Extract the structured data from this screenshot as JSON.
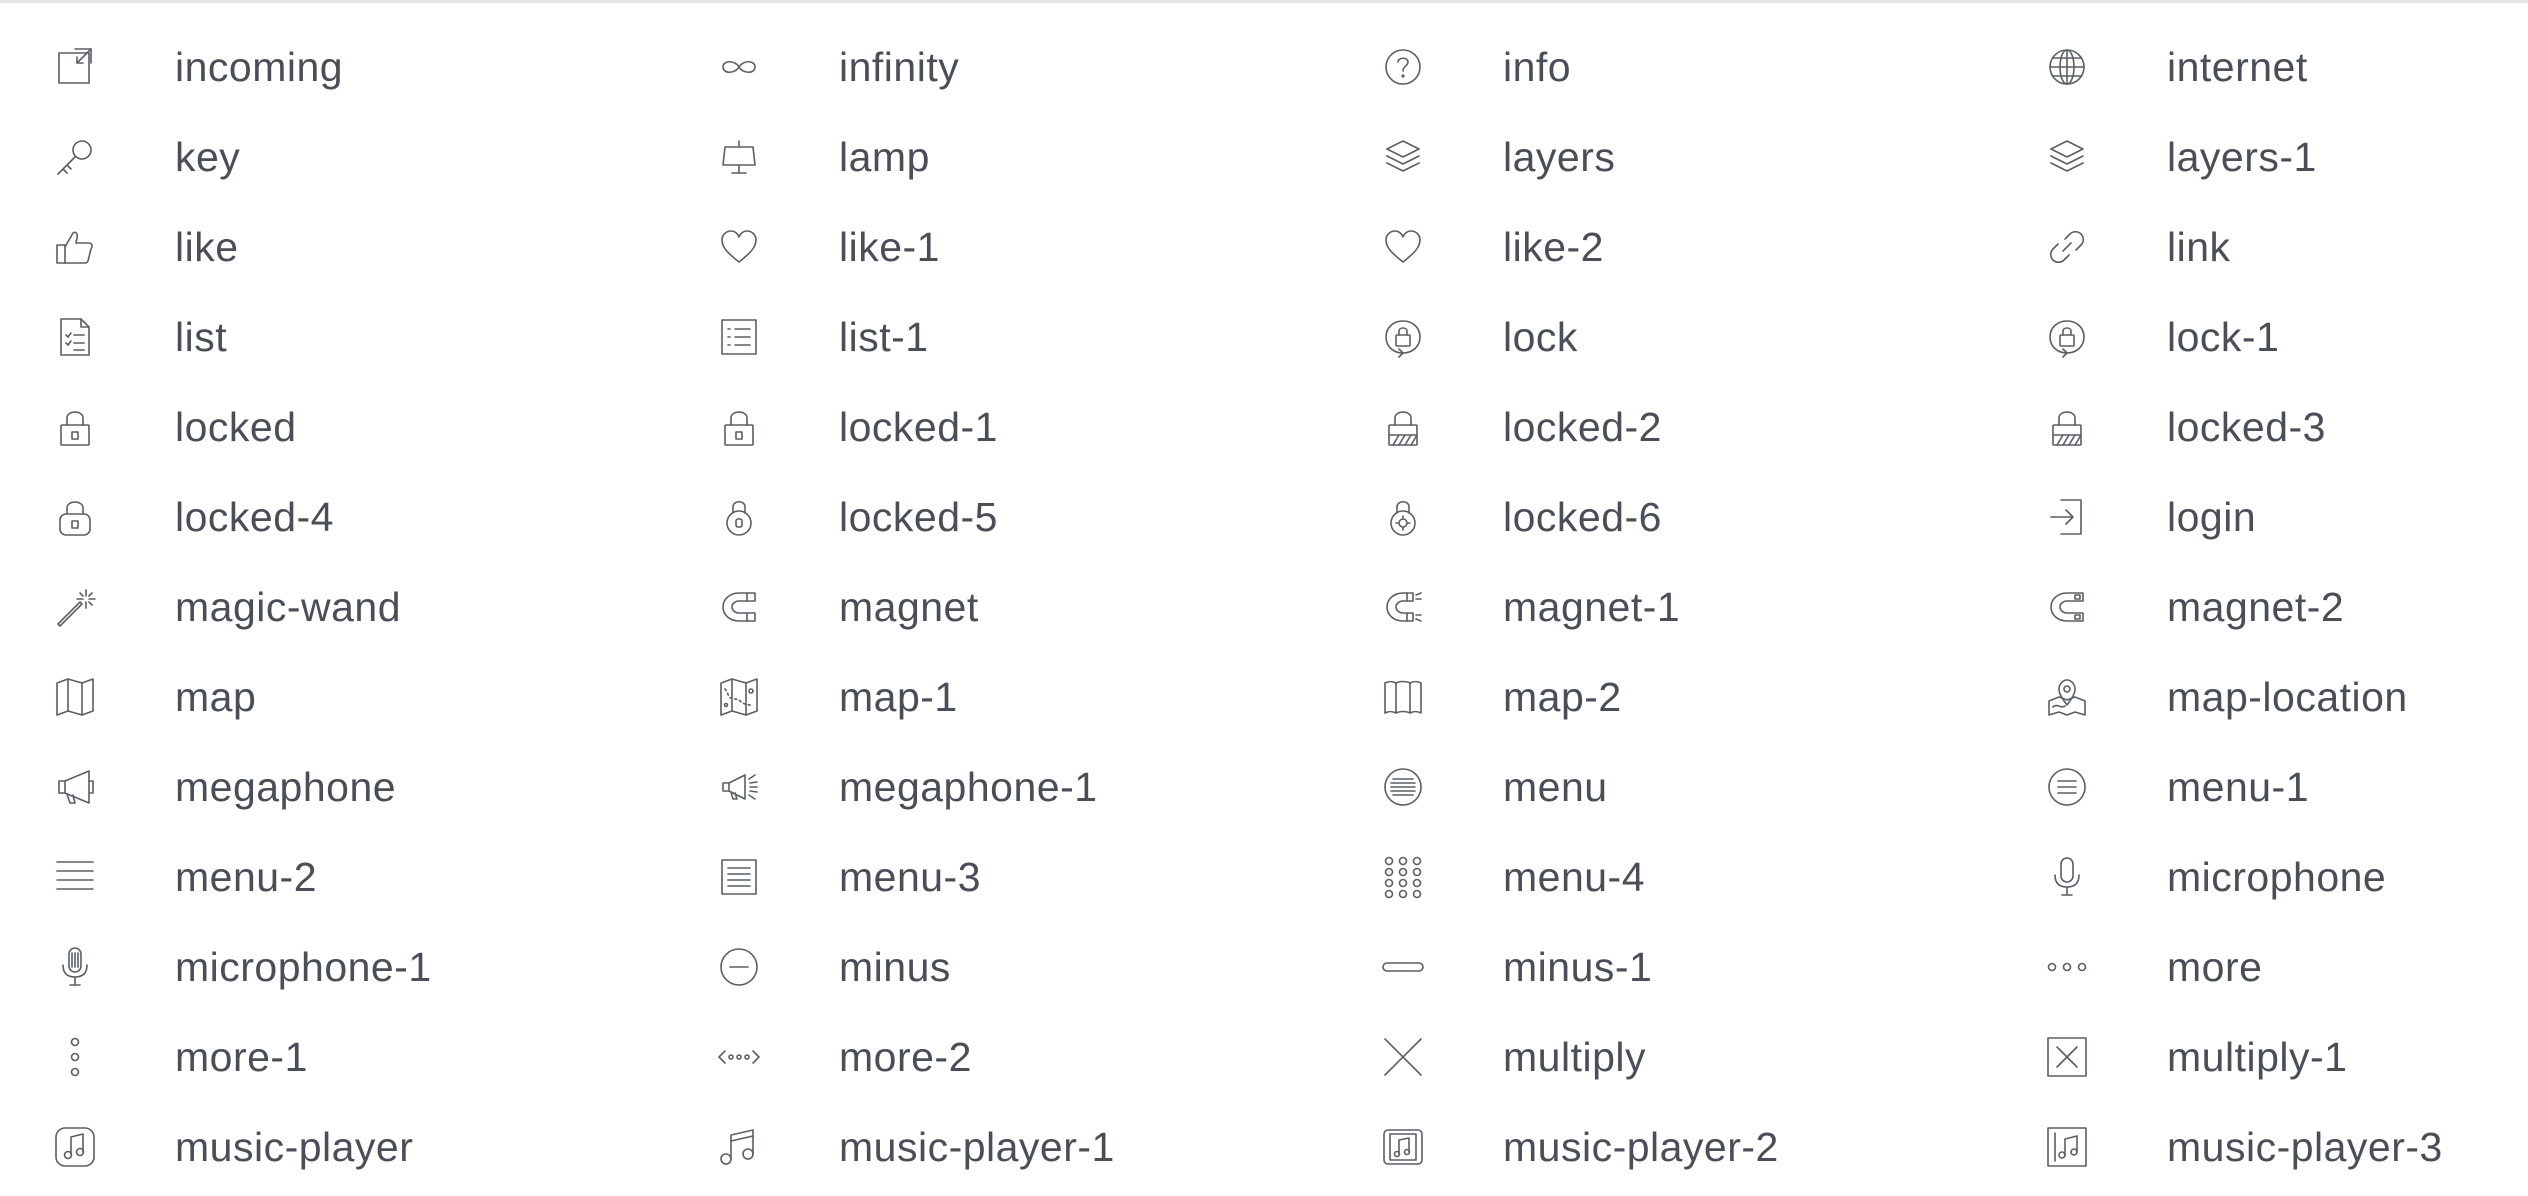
{
  "icons": [
    {
      "label": "incoming",
      "icon": "incoming-icon"
    },
    {
      "label": "infinity",
      "icon": "infinity-icon"
    },
    {
      "label": "info",
      "icon": "info-icon"
    },
    {
      "label": "internet",
      "icon": "internet-icon"
    },
    {
      "label": "key",
      "icon": "key-icon"
    },
    {
      "label": "lamp",
      "icon": "lamp-icon"
    },
    {
      "label": "layers",
      "icon": "layers-icon"
    },
    {
      "label": "layers-1",
      "icon": "layers-1-icon"
    },
    {
      "label": "like",
      "icon": "like-icon"
    },
    {
      "label": "like-1",
      "icon": "like-1-icon"
    },
    {
      "label": "like-2",
      "icon": "like-2-icon"
    },
    {
      "label": "link",
      "icon": "link-icon"
    },
    {
      "label": "list",
      "icon": "list-icon"
    },
    {
      "label": "list-1",
      "icon": "list-1-icon"
    },
    {
      "label": "lock",
      "icon": "lock-icon"
    },
    {
      "label": "lock-1",
      "icon": "lock-1-icon"
    },
    {
      "label": "locked",
      "icon": "locked-icon"
    },
    {
      "label": "locked-1",
      "icon": "locked-1-icon"
    },
    {
      "label": "locked-2",
      "icon": "locked-2-icon"
    },
    {
      "label": "locked-3",
      "icon": "locked-3-icon"
    },
    {
      "label": "locked-4",
      "icon": "locked-4-icon"
    },
    {
      "label": "locked-5",
      "icon": "locked-5-icon"
    },
    {
      "label": "locked-6",
      "icon": "locked-6-icon"
    },
    {
      "label": "login",
      "icon": "login-icon"
    },
    {
      "label": "magic-wand",
      "icon": "magic-wand-icon"
    },
    {
      "label": "magnet",
      "icon": "magnet-icon"
    },
    {
      "label": "magnet-1",
      "icon": "magnet-1-icon"
    },
    {
      "label": "magnet-2",
      "icon": "magnet-2-icon"
    },
    {
      "label": "map",
      "icon": "map-icon"
    },
    {
      "label": "map-1",
      "icon": "map-1-icon"
    },
    {
      "label": "map-2",
      "icon": "map-2-icon"
    },
    {
      "label": "map-location",
      "icon": "map-location-icon"
    },
    {
      "label": "megaphone",
      "icon": "megaphone-icon"
    },
    {
      "label": "megaphone-1",
      "icon": "megaphone-1-icon"
    },
    {
      "label": "menu",
      "icon": "menu-icon"
    },
    {
      "label": "menu-1",
      "icon": "menu-1-icon"
    },
    {
      "label": "menu-2",
      "icon": "menu-2-icon"
    },
    {
      "label": "menu-3",
      "icon": "menu-3-icon"
    },
    {
      "label": "menu-4",
      "icon": "menu-4-icon"
    },
    {
      "label": "microphone",
      "icon": "microphone-icon"
    },
    {
      "label": "microphone-1",
      "icon": "microphone-1-icon"
    },
    {
      "label": "minus",
      "icon": "minus-icon"
    },
    {
      "label": "minus-1",
      "icon": "minus-1-icon"
    },
    {
      "label": "more",
      "icon": "more-icon"
    },
    {
      "label": "more-1",
      "icon": "more-1-icon"
    },
    {
      "label": "more-2",
      "icon": "more-2-icon"
    },
    {
      "label": "multiply",
      "icon": "multiply-icon"
    },
    {
      "label": "multiply-1",
      "icon": "multiply-1-icon"
    },
    {
      "label": "music-player",
      "icon": "music-player-icon"
    },
    {
      "label": "music-player-1",
      "icon": "music-player-1-icon"
    },
    {
      "label": "music-player-2",
      "icon": "music-player-2-icon"
    },
    {
      "label": "music-player-3",
      "icon": "music-player-3-icon"
    }
  ],
  "colors": {
    "text": "#4a4e57",
    "icon_stroke": "#5a5e66",
    "rule": "#e3e4e7"
  }
}
